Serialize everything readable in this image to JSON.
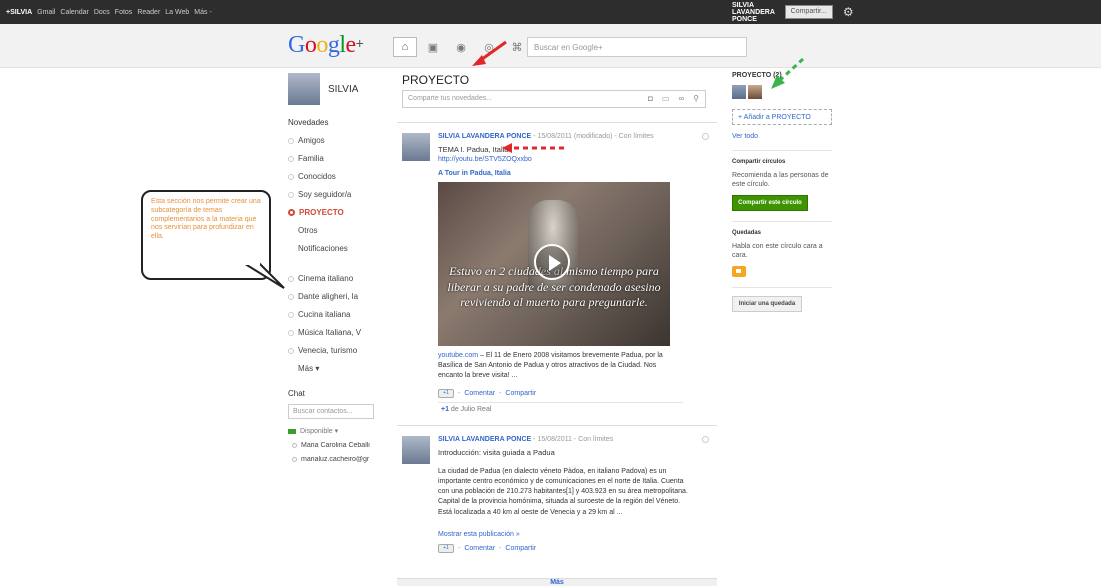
{
  "topbar": {
    "brand": "+SILVIA",
    "links": [
      "Gmail",
      "Calendar",
      "Docs",
      "Fotos",
      "Reader",
      "La Web",
      "Más -"
    ],
    "user_name": "SILVIA LAVANDERA PONCE",
    "share_label": "Compartir..."
  },
  "header": {
    "logo_text": "Google",
    "logo_plus": "+",
    "search_placeholder": "Buscar en Google+"
  },
  "sidebar": {
    "profile_name": "SILVIA",
    "streams_title": "Novedades",
    "items": [
      {
        "label": "Amigos"
      },
      {
        "label": "Familia"
      },
      {
        "label": "Conocidos"
      },
      {
        "label": "Soy seguidor/a"
      },
      {
        "label": "PROYECTO"
      },
      {
        "label": "Otros"
      },
      {
        "label": "Notificaciones"
      }
    ],
    "circles": [
      {
        "label": "Cinema italiano"
      },
      {
        "label": "Dante aligheri, la"
      },
      {
        "label": "Cucina italiana"
      },
      {
        "label": "Música Italiana, V"
      },
      {
        "label": "Venecia, turismo"
      }
    ],
    "more_label": "Más ▾",
    "chat_title": "Chat",
    "chat_search_placeholder": "Buscar contactos...",
    "availability": "Disponible ▾",
    "contacts": [
      "Maria Carolina Ceballi",
      "marialuz.cacheiro@gr"
    ]
  },
  "callout": {
    "text": "Esta sección nos permite crear una subcategoría de temas complementarios a la materia que nos servirían para profundizar en ella."
  },
  "stream": {
    "title": "PROYECTO",
    "share_placeholder": "Comparte tus novedades...",
    "posts": [
      {
        "author": "SILVIA LAVANDERA PONCE",
        "meta": " - 15/08/2011 (modificado) - Con límites",
        "headline": "TEMA I. Padua, Italia",
        "link": "http://youtu.be/STV5ZOQxxbo",
        "video_title": "A Tour in Padua, Italia",
        "video_caption": "Estuvo en 2 ciudades al mismo tiempo para liberar a su padre de ser condenado asesino reviviendo al muerto para preguntarle.",
        "source": "youtube.com",
        "description": " – El 11 de Enero 2008 visitamos brevemente Padua, por la Basílica de San Antonio de Padua y otros atractivos de la Ciudad. Nos encanto la breve visita! ...",
        "plusone_label": "+1",
        "comment_label": "Comentar",
        "share_label": "Compartir",
        "plusone_by_prefix": "+1",
        "plusone_by": " de Julio Real"
      },
      {
        "author": "SILVIA LAVANDERA PONCE",
        "meta": " - 15/08/2011 - Con límites",
        "headline": "Introducción: visita guiada a Padua",
        "body": "La ciudad de Padua (en dialecto véneto Pàdoa, en italiano Padova) es un importante centro económico y de comunicaciones en el norte de Italia. Cuenta con una población de 210.273 habitantes[1] y 403.923 en su área metropolitana. Capital de la provincia homónima, situada al suroeste de la región del Véneto. Está localizada a 40 km al oeste de Venecia y a 29 km al ...",
        "expand_label": "Mostrar esta publicación »",
        "plusone_label": "+1",
        "comment_label": "Comentar",
        "share_label": "Compartir"
      }
    ],
    "more_label": "Más"
  },
  "right_panel": {
    "circle_title": "PROYECTO (2)",
    "add_label": "+ Añadir a PROYECTO",
    "see_all": "Ver todo",
    "share_circles_title": "Compartir círculos",
    "share_circles_text": "Recomienda a las personas de este círculo.",
    "share_circle_button": "Compartir este círculo",
    "hangouts_title": "Quedadas",
    "hangouts_text": "Habla con este círculo cara a cara.",
    "hangout_button": "Iniciar una quedada"
  },
  "colors": {
    "accent_red": "#d14836",
    "link_blue": "#3366cc",
    "green_button": "#3d9400",
    "callout_text": "#e69138"
  }
}
